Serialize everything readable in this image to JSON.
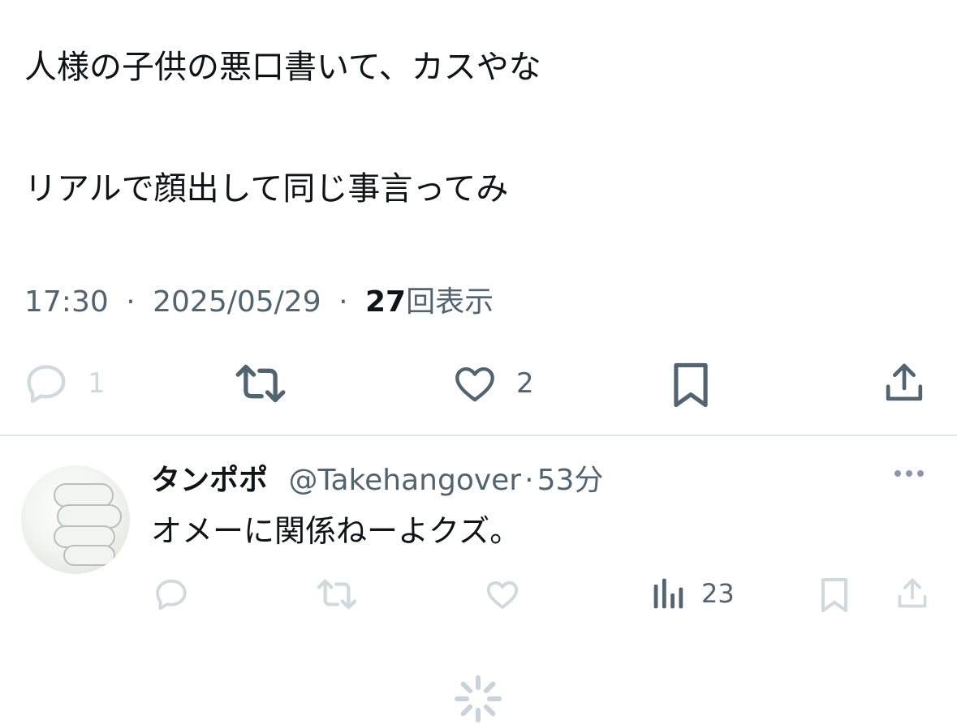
{
  "tweet": {
    "line1": "人様の子供の悪口書いて、カスやな",
    "line2": "リアルで顔出して同じ事言ってみ",
    "time": "17:30",
    "separator": "·",
    "date": "2025/05/29",
    "views_count": "27",
    "views_label": "回表示",
    "reply_count": "1",
    "like_count": "2"
  },
  "reply": {
    "name": "タンポポ",
    "handle": "@Takehangover",
    "separator": "·",
    "time": "53分",
    "text": "オメーに関係ねーよクズ。",
    "views_count": "23"
  },
  "icons": {
    "reply": "reply-icon",
    "retweet": "retweet-icon",
    "like": "heart-icon",
    "bookmark": "bookmark-icon",
    "share": "share-icon",
    "views": "views-icon",
    "more": "more-icon",
    "loading": "loading-spinner-icon"
  },
  "colors": {
    "text": "#0f1419",
    "secondary": "#536471",
    "muted": "#cfd9de",
    "divider": "#e1e8ed"
  }
}
